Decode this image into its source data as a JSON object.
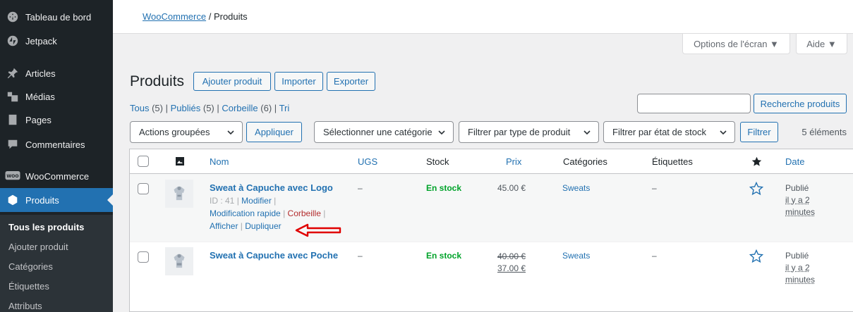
{
  "sidebar": {
    "items": [
      {
        "label": "Tableau de bord",
        "icon": "dashboard-icon"
      },
      {
        "label": "Jetpack",
        "icon": "jetpack-icon"
      },
      {
        "label": "Articles",
        "icon": "pin-icon"
      },
      {
        "label": "Médias",
        "icon": "media-icon"
      },
      {
        "label": "Pages",
        "icon": "pages-icon"
      },
      {
        "label": "Commentaires",
        "icon": "comments-icon"
      },
      {
        "label": "WooCommerce",
        "icon": "woo-icon"
      },
      {
        "label": "Produits",
        "icon": "products-icon"
      }
    ],
    "woo_badge": "WOO",
    "submenu": [
      "Tous les produits",
      "Ajouter produit",
      "Catégories",
      "Étiquettes",
      "Attributs"
    ]
  },
  "breadcrumb": {
    "link": "WooCommerce",
    "separator": "/",
    "current": "Produits"
  },
  "screen_options": {
    "options_label": "Options de l'écran ▼",
    "help_label": "Aide ▼"
  },
  "header": {
    "title": "Produits",
    "add_button": "Ajouter produit",
    "import_button": "Importer",
    "export_button": "Exporter"
  },
  "filters_views": [
    {
      "label": "Tous",
      "count": "(5)"
    },
    {
      "label": "Publiés",
      "count": "(5)"
    },
    {
      "label": "Corbeille",
      "count": "(6)"
    },
    {
      "label": "Tri",
      "count": ""
    }
  ],
  "search": {
    "placeholder": "",
    "button": "Recherche produits"
  },
  "toolbar": {
    "bulk_actions": "Actions groupées",
    "apply": "Appliquer",
    "category_select": "Sélectionner une catégorie",
    "type_select": "Filtrer par type de produit",
    "stock_select": "Filtrer par état de stock",
    "filter_button": "Filtrer",
    "items_count": "5 éléments"
  },
  "table": {
    "columns": {
      "name": "Nom",
      "sku": "UGS",
      "stock": "Stock",
      "price": "Prix",
      "categories": "Catégories",
      "tags": "Étiquettes",
      "date": "Date"
    },
    "rows": [
      {
        "name": "Sweat à Capuche avec Logo",
        "id_label": "ID : 41",
        "actions": {
          "edit": "Modifier",
          "quick_edit": "Modification rapide",
          "trash": "Corbeille",
          "view": "Afficher",
          "duplicate": "Dupliquer"
        },
        "sku": "–",
        "stock": "En stock",
        "price": "45.00 €",
        "category": "Sweats",
        "tags": "–",
        "status": "Publié",
        "date_ago_1": "il y a 2",
        "date_ago_2": "minutes"
      },
      {
        "name": "Sweat à Capuche avec Poche",
        "sku": "–",
        "stock": "En stock",
        "price_regular": "40.00 €",
        "price_sale": "37.00 €",
        "category": "Sweats",
        "tags": "–",
        "status": "Publié",
        "date_ago_1": "il y a 2",
        "date_ago_2": "minutes"
      }
    ]
  },
  "colors": {
    "accent": "#2271b1",
    "sidebar_bg": "#1d2327",
    "instock": "#00a32a",
    "trash": "#b32d2e",
    "annotation_arrow": "#e00000"
  }
}
